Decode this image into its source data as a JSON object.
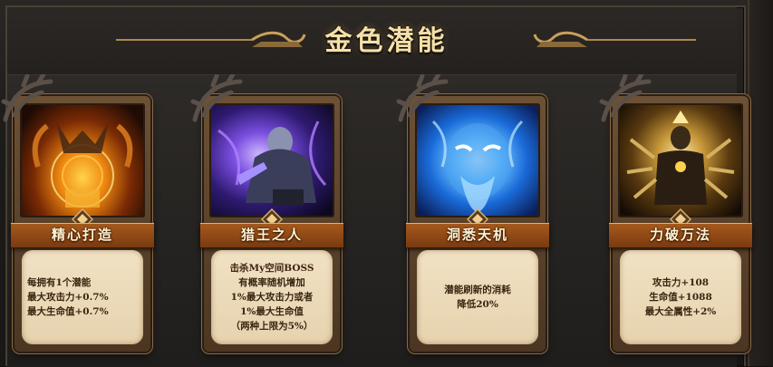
{
  "panel": {
    "title": "金色潜能"
  },
  "cards": [
    {
      "name": "精心打造",
      "art_icon": "golden-dragon-forge-icon",
      "description": [
        "每拥有1个潜能",
        "最大攻击力+0.7%",
        "最大生命值+0.7%"
      ],
      "accent": "#f0a030"
    },
    {
      "name": "猎王之人",
      "art_icon": "purple-armored-hunter-icon",
      "description": [
        "击杀My空间BOSS",
        "有概率随机增加",
        "1%最大攻击力或者",
        "1%最大生命值",
        "（两种上限为5%）"
      ],
      "accent": "#7a5cff"
    },
    {
      "name": "洞悉天机",
      "art_icon": "blue-ice-giant-face-icon",
      "description": [
        "潜能刷新的消耗",
        "降低20%"
      ],
      "accent": "#3aa8ff"
    },
    {
      "name": "力破万法",
      "art_icon": "golden-multi-armed-deity-icon",
      "description": [
        "攻击力+108",
        "生命值+1088",
        "最大全属性+2%"
      ],
      "accent": "#e8c060"
    }
  ]
}
